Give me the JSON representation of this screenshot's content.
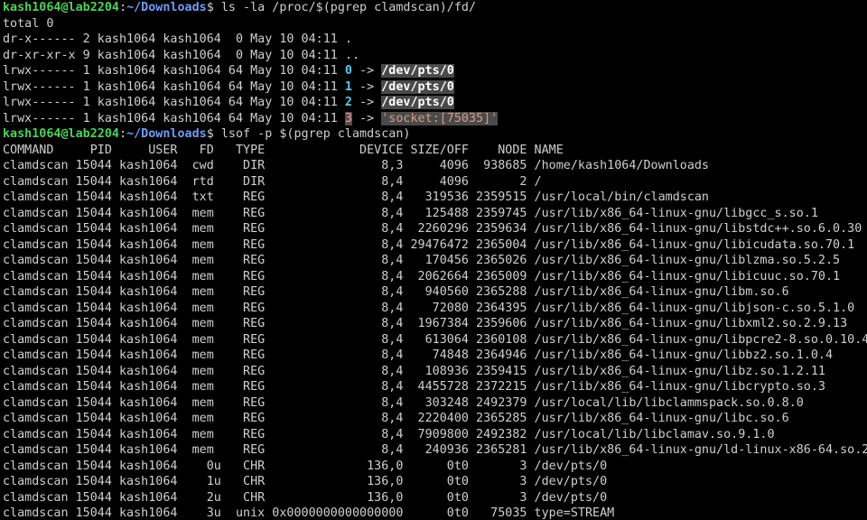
{
  "terminal": {
    "prompt": {
      "user_host": "kash1064@lab2204",
      "path": "~/Downloads",
      "symbol": "$"
    },
    "cmd1": "ls -la /proc/$(pgrep clamdscan)/fd/",
    "ls_total": "total 0",
    "ls_rows": [
      {
        "perms": "dr-x------",
        "links": "2",
        "owner": "kash1064",
        "group": "kash1064",
        "size": " 0",
        "date": "May 10 04:11",
        "name": ".",
        "arrow": "",
        "target": ""
      },
      {
        "perms": "dr-xr-xr-x",
        "links": "9",
        "owner": "kash1064",
        "group": "kash1064",
        "size": " 0",
        "date": "May 10 04:11",
        "name": "..",
        "arrow": "",
        "target": ""
      },
      {
        "perms": "lrwx------",
        "links": "1",
        "owner": "kash1064",
        "group": "kash1064",
        "size": "64",
        "date": "May 10 04:11",
        "name": "0",
        "arrow": "->",
        "target": "/dev/pts/0"
      },
      {
        "perms": "lrwx------",
        "links": "1",
        "owner": "kash1064",
        "group": "kash1064",
        "size": "64",
        "date": "May 10 04:11",
        "name": "1",
        "arrow": "->",
        "target": "/dev/pts/0"
      },
      {
        "perms": "lrwx------",
        "links": "1",
        "owner": "kash1064",
        "group": "kash1064",
        "size": "64",
        "date": "May 10 04:11",
        "name": "2",
        "arrow": "->",
        "target": "/dev/pts/0"
      },
      {
        "perms": "lrwx------",
        "links": "1",
        "owner": "kash1064",
        "group": "kash1064",
        "size": "64",
        "date": "May 10 04:11",
        "name": "3",
        "arrow": "->",
        "target": "'socket:[75035]'"
      }
    ],
    "cmd2": "lsof -p $(pgrep clamdscan)",
    "lsof_header": "COMMAND     PID     USER   FD   TYPE             DEVICE SIZE/OFF    NODE NAME",
    "lsof_rows": [
      "clamdscan 15044 kash1064  cwd    DIR                8,3     4096  938685 /home/kash1064/Downloads",
      "clamdscan 15044 kash1064  rtd    DIR                8,4     4096       2 /",
      "clamdscan 15044 kash1064  txt    REG                8,4   319536 2359515 /usr/local/bin/clamdscan",
      "clamdscan 15044 kash1064  mem    REG                8,4   125488 2359745 /usr/lib/x86_64-linux-gnu/libgcc_s.so.1",
      "clamdscan 15044 kash1064  mem    REG                8,4  2260296 2359634 /usr/lib/x86_64-linux-gnu/libstdc++.so.6.0.30",
      "clamdscan 15044 kash1064  mem    REG                8,4 29476472 2365004 /usr/lib/x86_64-linux-gnu/libicudata.so.70.1",
      "clamdscan 15044 kash1064  mem    REG                8,4   170456 2365026 /usr/lib/x86_64-linux-gnu/liblzma.so.5.2.5",
      "clamdscan 15044 kash1064  mem    REG                8,4  2062664 2365009 /usr/lib/x86_64-linux-gnu/libicuuc.so.70.1",
      "clamdscan 15044 kash1064  mem    REG                8,4   940560 2365288 /usr/lib/x86_64-linux-gnu/libm.so.6",
      "clamdscan 15044 kash1064  mem    REG                8,4    72080 2364395 /usr/lib/x86_64-linux-gnu/libjson-c.so.5.1.0",
      "clamdscan 15044 kash1064  mem    REG                8,4  1967384 2359606 /usr/lib/x86_64-linux-gnu/libxml2.so.2.9.13",
      "clamdscan 15044 kash1064  mem    REG                8,4   613064 2360108 /usr/lib/x86_64-linux-gnu/libpcre2-8.so.0.10.4",
      "clamdscan 15044 kash1064  mem    REG                8,4    74848 2364946 /usr/lib/x86_64-linux-gnu/libbz2.so.1.0.4",
      "clamdscan 15044 kash1064  mem    REG                8,4   108936 2359415 /usr/lib/x86_64-linux-gnu/libz.so.1.2.11",
      "clamdscan 15044 kash1064  mem    REG                8,4  4455728 2372215 /usr/lib/x86_64-linux-gnu/libcrypto.so.3",
      "clamdscan 15044 kash1064  mem    REG                8,4   303248 2492379 /usr/local/lib/libclammspack.so.0.8.0",
      "clamdscan 15044 kash1064  mem    REG                8,4  2220400 2365285 /usr/lib/x86_64-linux-gnu/libc.so.6",
      "clamdscan 15044 kash1064  mem    REG                8,4  7909800 2492382 /usr/local/lib/libclamav.so.9.1.0",
      "clamdscan 15044 kash1064  mem    REG                8,4   240936 2365281 /usr/lib/x86_64-linux-gnu/ld-linux-x86-64.so.2",
      "clamdscan 15044 kash1064    0u   CHR              136,0      0t0       3 /dev/pts/0",
      "clamdscan 15044 kash1064    1u   CHR              136,0      0t0       3 /dev/pts/0",
      "clamdscan 15044 kash1064    2u   CHR              136,0      0t0       3 /dev/pts/0",
      "clamdscan 15044 kash1064    3u  unix 0x0000000000000000      0t0   75035 type=STREAM"
    ],
    "colors": {
      "background": "#000000",
      "text": "#cfcfcf",
      "prompt_user": "#4fd15a",
      "prompt_path": "#6f9df5",
      "fd_number": "#5fc6e8",
      "socket_text": "#d89a8a"
    }
  }
}
